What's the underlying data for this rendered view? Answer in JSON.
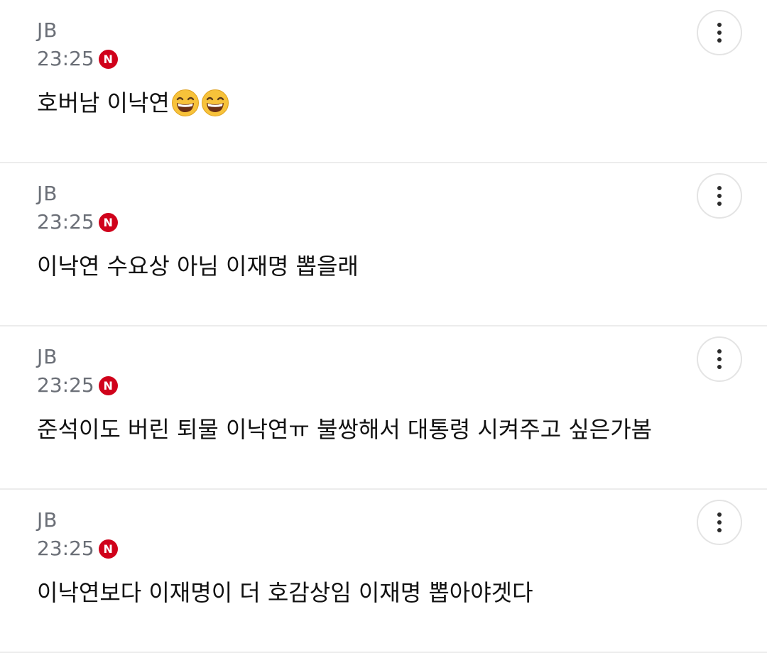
{
  "colors": {
    "meta_text": "#6b6f77",
    "badge_red": "#d0021b",
    "divider": "#ececec"
  },
  "comments": [
    {
      "author": "JB",
      "time": "23:25",
      "badge": "N",
      "text": "호버남 이낙연",
      "emojis": [
        "grinning-face-emoji",
        "grinning-face-emoji"
      ]
    },
    {
      "author": "JB",
      "time": "23:25",
      "badge": "N",
      "text": "이낙연 수요상 아님 이재명 뽑을래"
    },
    {
      "author": "JB",
      "time": "23:25",
      "badge": "N",
      "text": "준석이도 버린 퇴물 이낙연ㅠ 불쌍해서 대통령 시켜주고 싶은가봄"
    },
    {
      "author": "JB",
      "time": "23:25",
      "badge": "N",
      "text": "이낙연보다 이재명이 더 호감상임 이재명 뽑아야겟다"
    }
  ],
  "icons": {
    "more": "more-vertical-icon",
    "badge": "naver-n-icon"
  }
}
